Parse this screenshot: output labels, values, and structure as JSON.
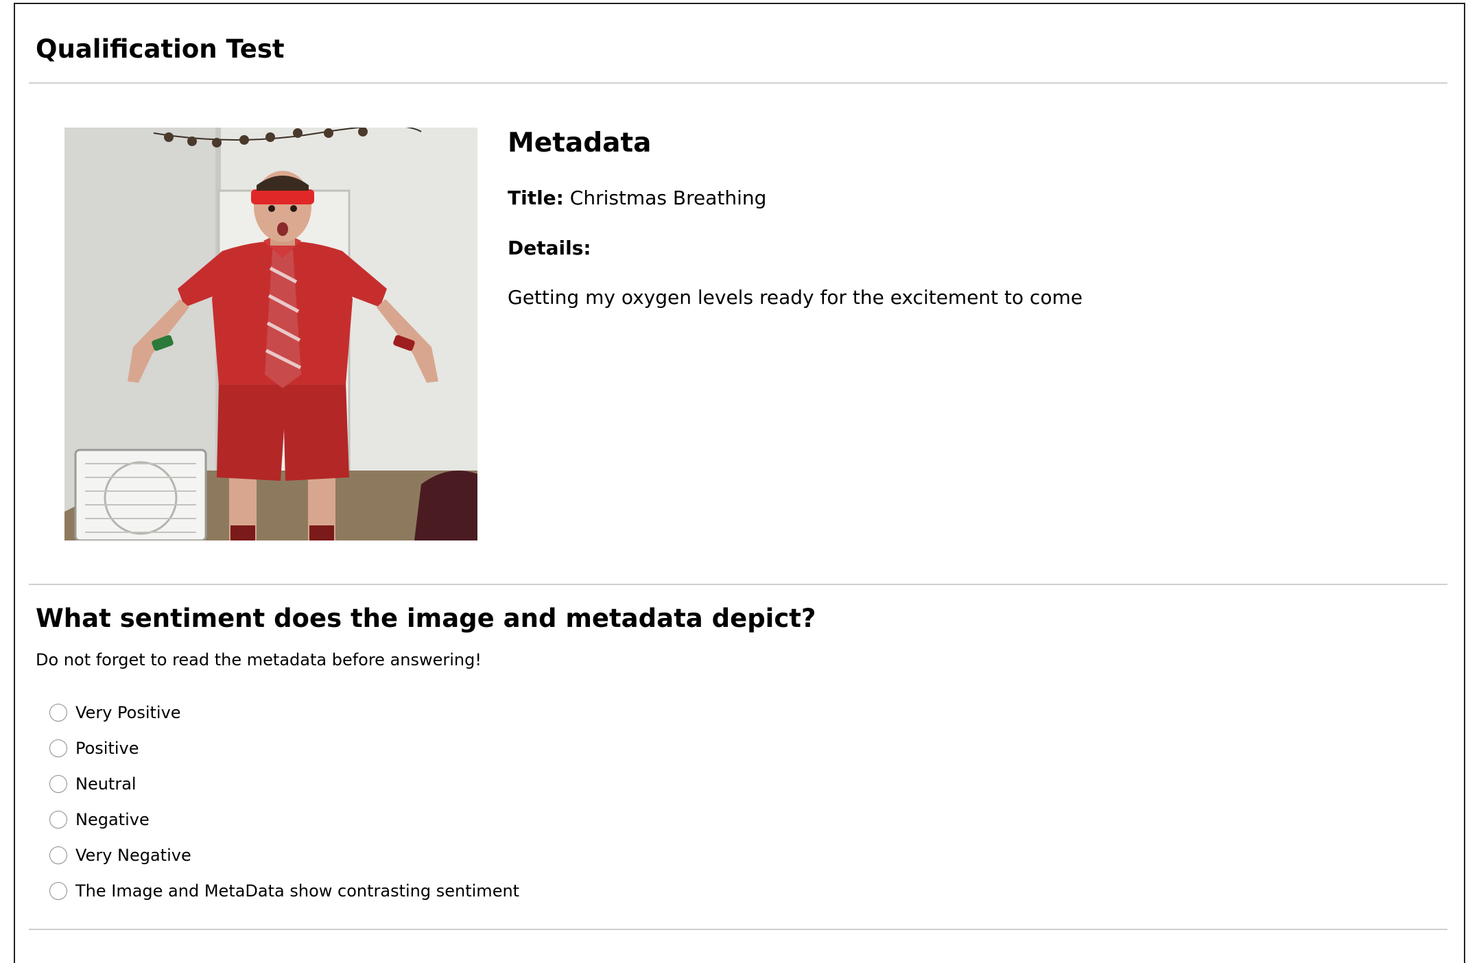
{
  "page": {
    "title": "Qualification Test"
  },
  "photo": {
    "alt": "Man in red shirt, striped tie and red shorts with red headband"
  },
  "metadata": {
    "heading": "Metadata",
    "title_label": "Title:",
    "title_value": "Christmas Breathing",
    "details_label": "Details:",
    "details_text": "Getting my oxygen levels ready for the excitement to come"
  },
  "question": {
    "text": "What sentiment does the image and metadata depict?",
    "hint": "Do not forget to read the metadata before answering!",
    "options": [
      {
        "label": "Very Positive"
      },
      {
        "label": "Positive"
      },
      {
        "label": "Neutral"
      },
      {
        "label": "Negative"
      },
      {
        "label": "Very Negative"
      },
      {
        "label": "The Image and MetaData show contrasting sentiment"
      }
    ]
  }
}
